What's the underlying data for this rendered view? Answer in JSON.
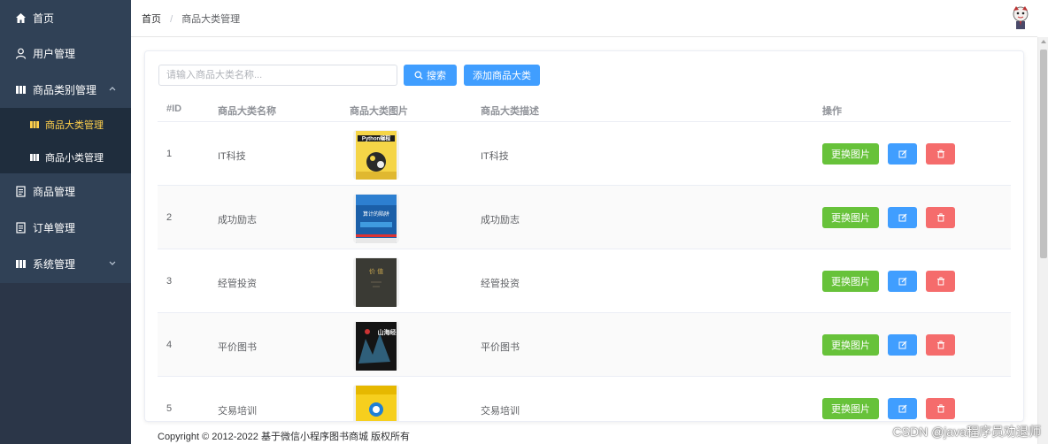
{
  "sidebar": {
    "items": [
      {
        "label": "首页",
        "icon": "home-icon"
      },
      {
        "label": "用户管理",
        "icon": "user-icon"
      },
      {
        "label": "商品类别管理",
        "icon": "category-icon"
      },
      {
        "label": "商品管理",
        "icon": "document-icon"
      },
      {
        "label": "订单管理",
        "icon": "document-icon"
      },
      {
        "label": "系统管理",
        "icon": "category-icon"
      }
    ],
    "sub_items": [
      {
        "label": "商品大类管理",
        "active": true
      },
      {
        "label": "商品小类管理",
        "active": false
      }
    ],
    "active_color": "#ffd04b",
    "bg_color": "#304156"
  },
  "header": {
    "breadcrumb": [
      "首页",
      "商品大类管理"
    ],
    "separator": "/"
  },
  "toolbar": {
    "search_placeholder": "请输入商品大类名称...",
    "search_label": "搜索",
    "add_label": "添加商品大类"
  },
  "table": {
    "headers": {
      "id": "#ID",
      "name": "商品大类名称",
      "image": "商品大类图片",
      "desc": "商品大类描述",
      "actions": "操作"
    },
    "rows": [
      {
        "id": "1",
        "name": "IT科技",
        "desc": "IT科技",
        "cover_text": "Python编程"
      },
      {
        "id": "2",
        "name": "成功励志",
        "desc": "成功励志",
        "cover_text": "算计的陷阱"
      },
      {
        "id": "3",
        "name": "经管投资",
        "desc": "经管投资",
        "cover_text": "价 值"
      },
      {
        "id": "4",
        "name": "平价图书",
        "desc": "平价图书",
        "cover_text": "山海经"
      },
      {
        "id": "5",
        "name": "交易培训",
        "desc": "交易培训",
        "cover_text": ""
      }
    ],
    "change_image_label": "更换图片"
  },
  "footer": {
    "text": "Copyright © 2012-2022 基于微信小程序图书商城 版权所有"
  },
  "watermark": "CSDN @java程序员劝退师",
  "colors": {
    "primary": "#409eff",
    "success": "#67c23a",
    "danger": "#f56c6c"
  }
}
